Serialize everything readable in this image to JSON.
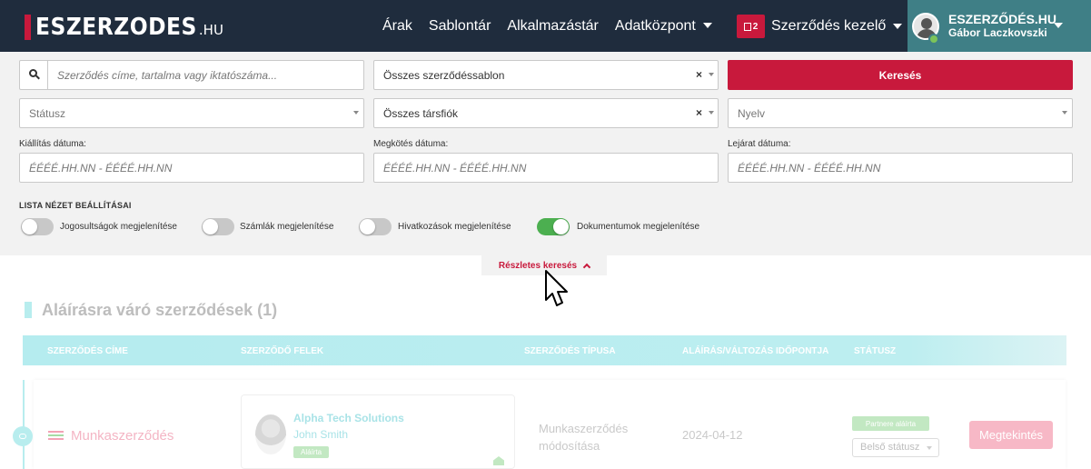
{
  "header": {
    "logo_main": "ESZERZODES",
    "logo_suffix": ".HU",
    "nav": {
      "prices": "Árak",
      "templates": "Sablontár",
      "apps": "Alkalmazástár",
      "data_center": "Adatközpont"
    },
    "contract_manager": {
      "badge": "2",
      "label": "Szerződés kezelő"
    },
    "user": {
      "org": "ESZERZŐDÉS.HU",
      "name": "Gábor Laczkovszki"
    }
  },
  "search": {
    "query_placeholder": "Szerződés címe, tartalma vagy iktatószáma...",
    "template_value": "Összes szerződéssablon",
    "search_button": "Keresés",
    "status_placeholder": "Státusz",
    "subaccount_value": "Összes társfiók",
    "language_placeholder": "Nyelv",
    "issue_date_label": "Kiállítás dátuma:",
    "signing_date_label": "Megkötés dátuma:",
    "expiry_date_label": "Lejárat dátuma:",
    "date_placeholder": "ÉÉÉÉ.HH.NN - ÉÉÉÉ.HH.NN",
    "clear_symbol": "×"
  },
  "list_settings": {
    "title": "LISTA NÉZET BEÁLLÍTÁSAI",
    "toggles": [
      {
        "label": "Jogosultságok megjelenítése",
        "on": false
      },
      {
        "label": "Számlák megjelenítése",
        "on": false
      },
      {
        "label": "Hivatkozások megjelenítése",
        "on": false
      },
      {
        "label": "Dokumentumok megjelenítése",
        "on": true
      }
    ]
  },
  "advanced_search": {
    "label": "Részletes keresés"
  },
  "pending": {
    "title": "Aláírásra váró szerződések (1)",
    "columns": [
      "SZERZŐDÉS CÍME",
      "SZERZŐDŐ FELEK",
      "SZERZŐDÉS TÍPUSA",
      "ALÁÍRÁS/VÁLTOZÁS IDŐPONTJA",
      "STÁTUSZ"
    ],
    "rows": [
      {
        "title": "Munkaszerződés",
        "party_org": "Alpha Tech Solutions",
        "party_person": "John Smith",
        "party_badge": "Aláírta",
        "type_line1": "Munkaszerződés",
        "type_line2": "módosítása",
        "date": "2024-04-12",
        "status_badge": "Partnere aláírta",
        "internal_status": "Belső státusz",
        "view_button": "Megtekintés"
      }
    ]
  },
  "colors": {
    "header_bg": "#1f2c3d",
    "brand_red": "#c8193c",
    "user_block": "#3f7f86",
    "toggle_on": "#4caf50",
    "table_head": "#b5ecef"
  }
}
